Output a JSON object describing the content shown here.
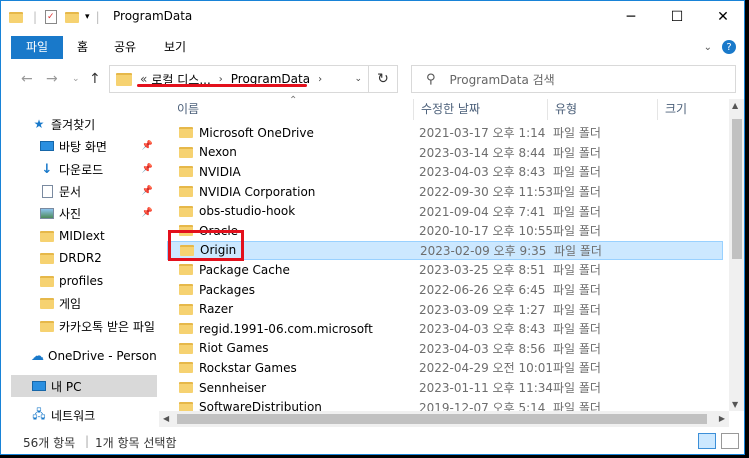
{
  "window": {
    "title": "ProgramData"
  },
  "ribbon": {
    "tabs": [
      "파일",
      "홈",
      "공유",
      "보기"
    ]
  },
  "address": {
    "overflow": "«",
    "crumb1": "로컬 디스...",
    "crumb2": "ProgramData"
  },
  "search": {
    "placeholder": "ProgramData 검색"
  },
  "nav": {
    "quick_access": "즐겨찾기",
    "items": [
      "바탕 화면",
      "다운로드",
      "문서",
      "사진",
      "MIDIext",
      "DRDR2",
      "profiles",
      "게임",
      "카카오톡 받은 파일"
    ],
    "onedrive": "OneDrive - Personal",
    "thispc": "내 PC",
    "network": "네트워크"
  },
  "columns": {
    "name": "이름",
    "date": "수정한 날짜",
    "type": "유형",
    "size": "크기"
  },
  "files": [
    {
      "name": "Microsoft OneDrive",
      "date": "2021-03-17 오후 1:14",
      "type": "파일 폴더"
    },
    {
      "name": "Nexon",
      "date": "2023-03-14 오후 8:44",
      "type": "파일 폴더"
    },
    {
      "name": "NVIDIA",
      "date": "2023-04-03 오후 8:43",
      "type": "파일 폴더"
    },
    {
      "name": "NVIDIA Corporation",
      "date": "2022-09-30 오후 11:53",
      "type": "파일 폴더"
    },
    {
      "name": "obs-studio-hook",
      "date": "2021-09-04 오후 7:41",
      "type": "파일 폴더"
    },
    {
      "name": "Oracle",
      "date": "2020-10-17 오후 10:55",
      "type": "파일 폴더"
    },
    {
      "name": "Origin",
      "date": "2023-02-09 오후 9:35",
      "type": "파일 폴더"
    },
    {
      "name": "Package Cache",
      "date": "2023-03-25 오후 8:51",
      "type": "파일 폴더"
    },
    {
      "name": "Packages",
      "date": "2022-06-26 오후 6:45",
      "type": "파일 폴더"
    },
    {
      "name": "Razer",
      "date": "2023-03-09 오후 1:27",
      "type": "파일 폴더"
    },
    {
      "name": "regid.1991-06.com.microsoft",
      "date": "2023-04-03 오후 8:43",
      "type": "파일 폴더"
    },
    {
      "name": "Riot Games",
      "date": "2023-04-03 오후 8:56",
      "type": "파일 폴더"
    },
    {
      "name": "Rockstar Games",
      "date": "2022-04-29 오전 10:01",
      "type": "파일 폴더"
    },
    {
      "name": "Sennheiser",
      "date": "2023-01-11 오후 11:34",
      "type": "파일 폴더"
    },
    {
      "name": "SoftwareDistribution",
      "date": "2019-12-07 오후 5:14",
      "type": "파일 폴더"
    }
  ],
  "status": {
    "count": "56개 항목",
    "selected": "1개 항목 선택함"
  },
  "colors": {
    "accent": "#1979ca",
    "selection": "#cce8ff",
    "annotation": "#e3101c"
  }
}
